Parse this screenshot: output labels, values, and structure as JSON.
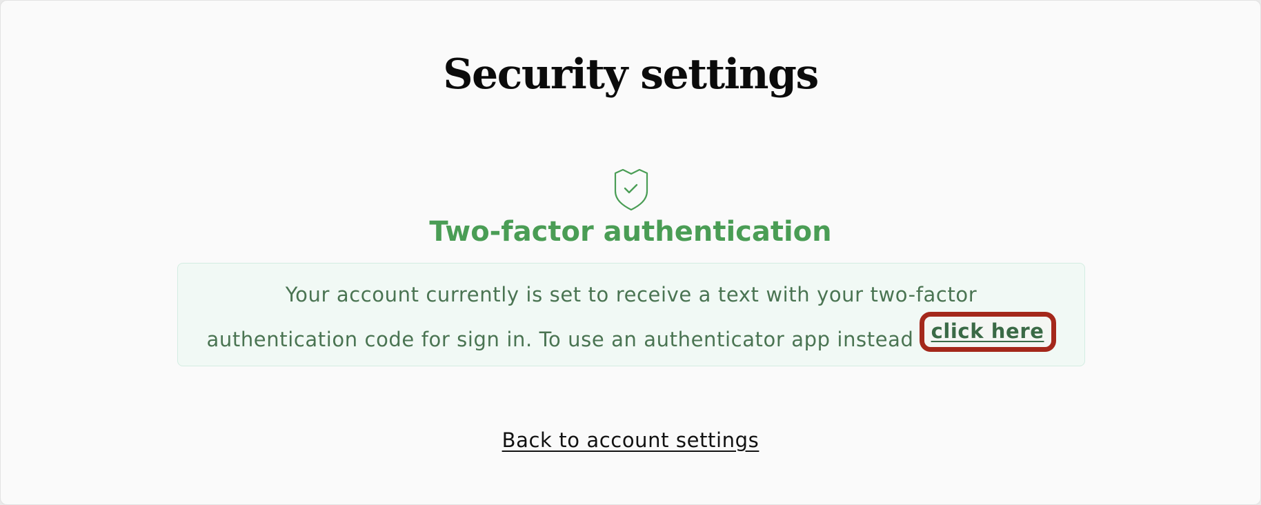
{
  "page": {
    "title": "Security settings"
  },
  "two_factor": {
    "icon": "shield-check-icon",
    "heading": "Two-factor authentication",
    "notice_line1": "Your account currently is set to receive a text with your two-factor",
    "notice_line2": "authentication code for sign in. To use an authenticator app instead",
    "link_label": "click here"
  },
  "footer": {
    "back_label": "Back to account settings"
  },
  "colors": {
    "accent_green": "#4a9d55",
    "notice_background": "#f1f9f5",
    "highlight_outline": "#a4281b"
  }
}
